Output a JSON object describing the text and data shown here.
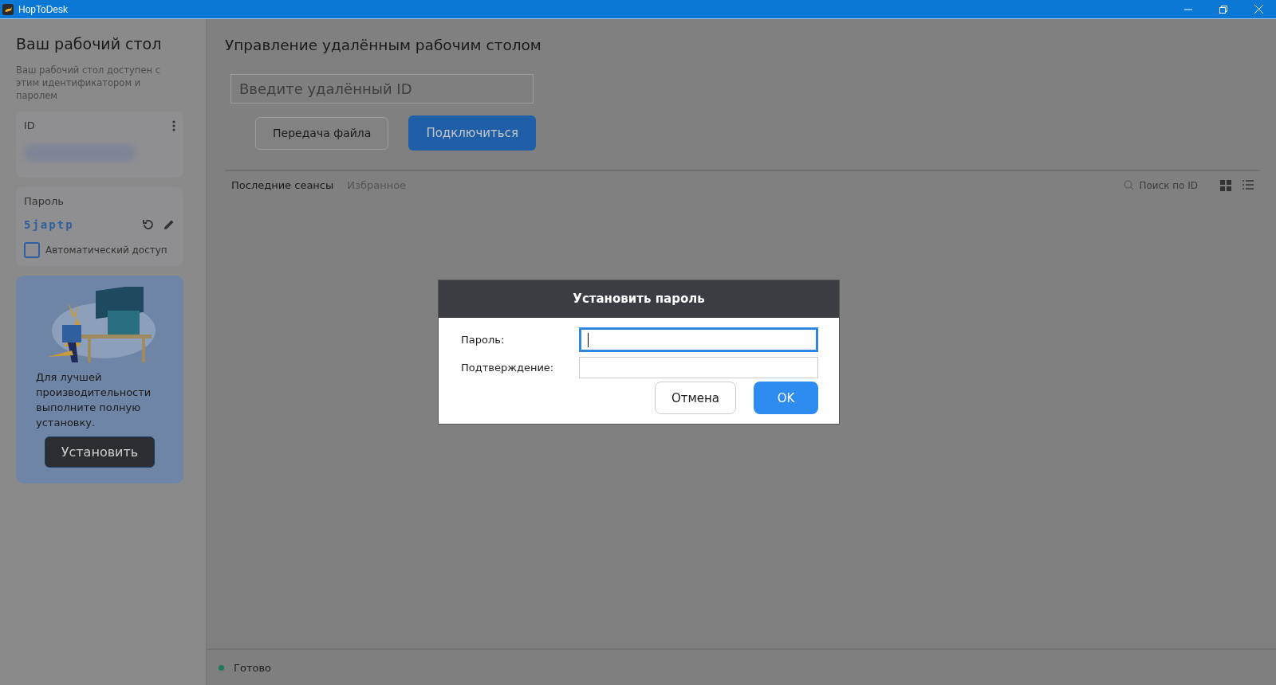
{
  "window": {
    "title": "HopToDesk"
  },
  "sidebar": {
    "title": "Ваш рабочий стол",
    "description": "Ваш рабочий стол доступен с этим идентификатором и паролем",
    "id_card": {
      "label": "ID"
    },
    "password_card": {
      "label": "Пароль",
      "value": "5japtp",
      "auto_access": {
        "label": "Автоматический доступ",
        "checked": false
      }
    },
    "promo": {
      "text": "Для лучшей производительности выполните полную установку.",
      "button": "Установить"
    }
  },
  "main": {
    "title": "Управление удалённым рабочим столом",
    "remote_id": {
      "placeholder": "Введите удалённый ID"
    },
    "buttons": [
      {
        "label": "Передача файла",
        "kind": "secondary"
      },
      {
        "label": "Подключиться",
        "kind": "primary"
      }
    ],
    "tabs": [
      {
        "label": "Последние сеансы",
        "selected": true
      },
      {
        "label": "Избранное",
        "selected": false
      }
    ],
    "search": {
      "placeholder": "Поиск по ID"
    }
  },
  "dialog": {
    "title": "Установить пароль",
    "fields": [
      {
        "label": "Пароль:",
        "focused": true
      },
      {
        "label": "Подтверждение:",
        "focused": false
      }
    ],
    "buttons": [
      {
        "label": "Отмена",
        "kind": "secondary"
      },
      {
        "label": "OK",
        "kind": "primary"
      }
    ]
  },
  "status_bar": {
    "text": "Готово"
  }
}
